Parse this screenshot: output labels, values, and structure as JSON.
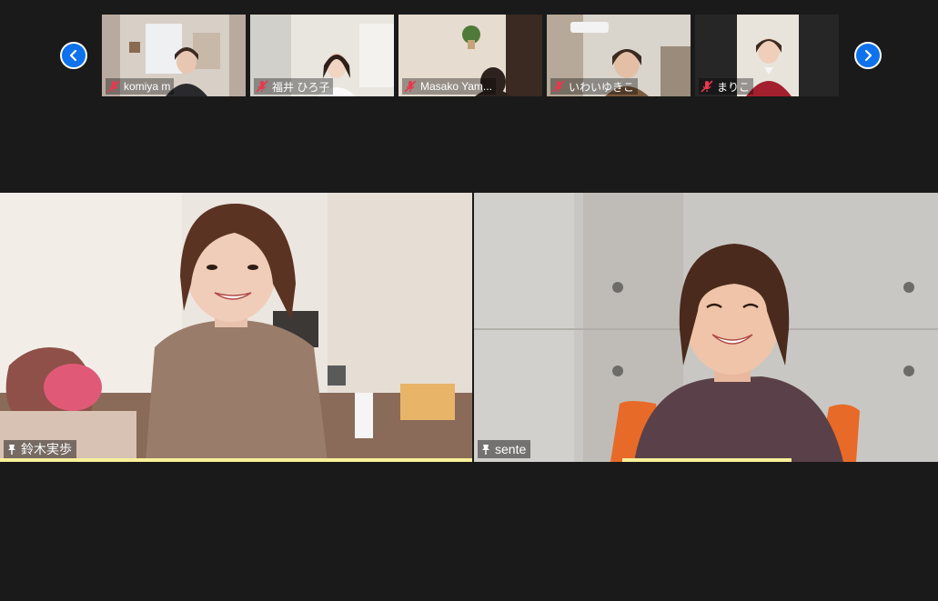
{
  "gallery": {
    "thumbnails": [
      {
        "name": "komiya m",
        "muted": true
      },
      {
        "name": "福井 ひろ子",
        "muted": true
      },
      {
        "name": "Masako Yam...",
        "muted": true
      },
      {
        "name": "いわいゆきこ",
        "muted": true
      },
      {
        "name": "まりこ",
        "muted": true
      }
    ]
  },
  "main": {
    "tiles": [
      {
        "name": "鈴木実歩",
        "pinned": true,
        "active_speaker": true
      },
      {
        "name": "sente",
        "pinned": true,
        "active_speaker": false
      }
    ]
  },
  "colors": {
    "nav_button": "#0e72ed",
    "active_border": "#b9e23d",
    "mic_off": "#e8384f",
    "background": "#1a1a1a"
  }
}
